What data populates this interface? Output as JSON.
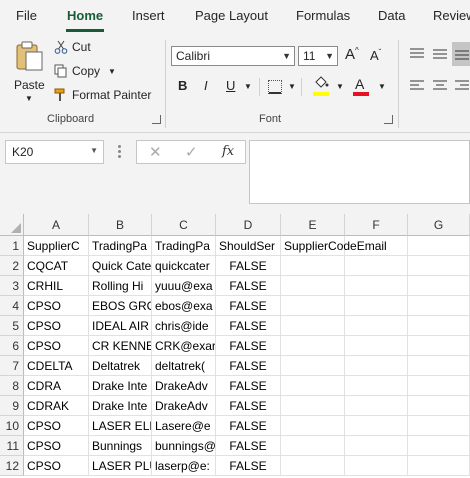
{
  "ribbon_tabs": [
    {
      "label": "File",
      "active": false
    },
    {
      "label": "Home",
      "active": true
    },
    {
      "label": "Insert",
      "active": false
    },
    {
      "label": "Page Layout",
      "active": false
    },
    {
      "label": "Formulas",
      "active": false
    },
    {
      "label": "Data",
      "active": false
    },
    {
      "label": "Review",
      "active": false
    }
  ],
  "clipboard": {
    "paste_label": "Paste",
    "cut_label": "Cut",
    "copy_label": "Copy",
    "format_painter_label": "Format Painter",
    "group_label": "Clipboard"
  },
  "font": {
    "font_name": "Calibri",
    "font_size": "11",
    "grow_label": "A",
    "shrink_label": "A",
    "bold": "B",
    "italic": "I",
    "underline": "U",
    "font_color_label": "A",
    "group_label": "Font",
    "fill_color": "#ffff00",
    "font_color": "#e81123"
  },
  "formula_bar": {
    "name_box": "K20",
    "fx_label": "fx",
    "formula": ""
  },
  "columns": [
    "A",
    "B",
    "C",
    "D",
    "E",
    "F",
    "G"
  ],
  "rows": [
    {
      "num": "1",
      "cells": [
        "SupplierC",
        "TradingPa",
        "TradingPa",
        "ShouldSer",
        "SupplierCodeEmail",
        "",
        ""
      ]
    },
    {
      "num": "2",
      "cells": [
        "CQCAT",
        "Quick Cate",
        "quickcater",
        "FALSE",
        "",
        "",
        ""
      ]
    },
    {
      "num": "3",
      "cells": [
        "CRHIL",
        "Rolling Hi",
        "yuuu@exa",
        "FALSE",
        "",
        "",
        ""
      ]
    },
    {
      "num": "4",
      "cells": [
        "CPSO",
        "EBOS GRO",
        "ebos@exa",
        "FALSE",
        "",
        "",
        ""
      ]
    },
    {
      "num": "5",
      "cells": [
        "CPSO",
        "IDEAL AIR",
        "chris@ide",
        "FALSE",
        "",
        "",
        ""
      ]
    },
    {
      "num": "6",
      "cells": [
        "CPSO",
        "CR KENNE",
        "CRK@exar",
        "FALSE",
        "",
        "",
        ""
      ]
    },
    {
      "num": "7",
      "cells": [
        "CDELTA",
        "Deltatrek",
        "deltatrek(",
        "FALSE",
        "",
        "",
        ""
      ]
    },
    {
      "num": "8",
      "cells": [
        "CDRA",
        "Drake Inte",
        "DrakeAdv",
        "FALSE",
        "",
        "",
        ""
      ]
    },
    {
      "num": "9",
      "cells": [
        "CDRAK",
        "Drake Inte",
        "DrakeAdv",
        "FALSE",
        "",
        "",
        ""
      ]
    },
    {
      "num": "10",
      "cells": [
        "CPSO",
        "LASER ELE",
        "Lasere@e",
        "FALSE",
        "",
        "",
        ""
      ]
    },
    {
      "num": "11",
      "cells": [
        "CPSO",
        "Bunnings",
        "bunnings@",
        "FALSE",
        "",
        "",
        ""
      ]
    },
    {
      "num": "12",
      "cells": [
        "CPSO",
        "LASER PLU",
        "laserp@e:",
        "FALSE",
        "",
        "",
        ""
      ]
    }
  ]
}
